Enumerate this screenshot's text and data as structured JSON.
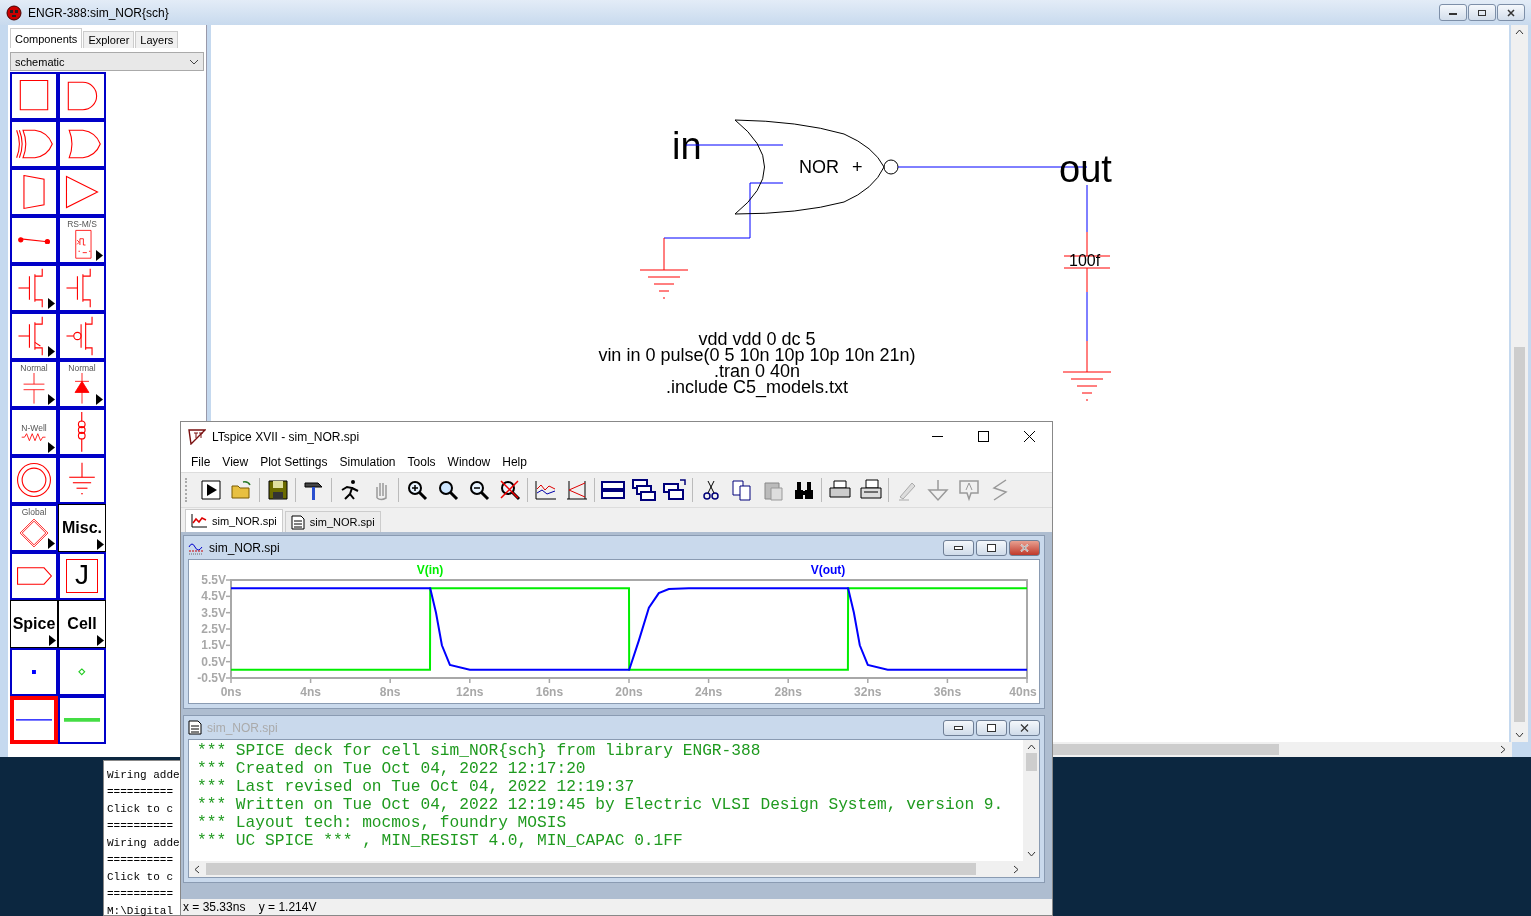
{
  "window": {
    "title": "ENGR-388:sim_NOR{sch}"
  },
  "side_tabs": [
    {
      "label": "Components",
      "selected": true
    },
    {
      "label": "Explorer",
      "selected": false
    },
    {
      "label": "Layers",
      "selected": false
    }
  ],
  "palette_select": {
    "value": "schematic"
  },
  "palette": [
    {
      "kind": "box",
      "menu": false,
      "selected": false
    },
    {
      "kind": "and",
      "menu": false,
      "selected": false
    },
    {
      "kind": "xor",
      "menu": false,
      "selected": false
    },
    {
      "kind": "or",
      "menu": false,
      "selected": false
    },
    {
      "kind": "mux",
      "menu": false,
      "selected": false
    },
    {
      "kind": "buffer",
      "menu": false,
      "selected": false
    },
    {
      "kind": "switch",
      "menu": false,
      "selected": false
    },
    {
      "kind": "flipflop",
      "label": "RS-M/S",
      "menu": true,
      "selected": false
    },
    {
      "kind": "nmos",
      "menu": true,
      "selected": false
    },
    {
      "kind": "mosfet",
      "menu": false,
      "selected": false
    },
    {
      "kind": "nmos4",
      "menu": true,
      "selected": false
    },
    {
      "kind": "pmos",
      "menu": false,
      "selected": false
    },
    {
      "kind": "capacitor",
      "label": "Normal",
      "menu": true,
      "selected": false
    },
    {
      "kind": "diode",
      "label": "Normal",
      "menu": true,
      "selected": false
    },
    {
      "kind": "resistor",
      "label": "N-Well",
      "menu": true,
      "selected": false
    },
    {
      "kind": "inductor",
      "menu": false,
      "selected": false
    },
    {
      "kind": "source",
      "menu": false,
      "selected": false
    },
    {
      "kind": "ground",
      "menu": false,
      "selected": false
    },
    {
      "kind": "global",
      "label": "Global",
      "menu": true,
      "selected": false
    },
    {
      "kind": "text",
      "label": "Misc.",
      "menu": true,
      "selected": false
    },
    {
      "kind": "export",
      "menu": false,
      "selected": false
    },
    {
      "kind": "jbox",
      "label": "J",
      "menu": false,
      "selected": false
    },
    {
      "kind": "text",
      "label": "Spice",
      "menu": true,
      "selected": false
    },
    {
      "kind": "text",
      "label": "Cell",
      "menu": true,
      "selected": false
    },
    {
      "kind": "pin",
      "menu": false,
      "selected": false
    },
    {
      "kind": "pin2",
      "menu": false,
      "selected": false
    },
    {
      "kind": "wire",
      "menu": false,
      "selected": true
    },
    {
      "kind": "wire2",
      "menu": false,
      "selected": false
    }
  ],
  "schematic": {
    "input_label": "in",
    "gate_label": "NOR",
    "gate_mark": "+",
    "output_label": "out",
    "capacitor_value": "100f",
    "spice_lines": [
      "vdd vdd 0 dc 5",
      "vin in 0 pulse(0 5 10n 10p 10p 10n 21n)",
      ".tran 0 40n",
      ".include C5_models.txt"
    ]
  },
  "messages": [
    "Wiring adde",
    "==========",
    "Click to c",
    "==========",
    "Wiring adde",
    "==========",
    "Click to c",
    "==========",
    "M:\\Digital"
  ],
  "ltspice": {
    "title": "LTspice XVII - sim_NOR.spi",
    "menu": [
      "File",
      "View",
      "Plot Settings",
      "Simulation",
      "Tools",
      "Window",
      "Help"
    ],
    "tabs": [
      {
        "label": "sim_NOR.spi",
        "kind": "plot",
        "selected": true
      },
      {
        "label": "sim_NOR.spi",
        "kind": "netlist",
        "selected": false
      }
    ],
    "plot_window": {
      "title": "sim_NOR.spi",
      "active": true,
      "chart_data": {
        "type": "line",
        "x": [
          0,
          10,
          10.01,
          10.3,
          10.6,
          11,
          12,
          20,
          20.01,
          20.5,
          21,
          21.5,
          22,
          23,
          31,
          31.01,
          31.3,
          31.6,
          32,
          33,
          40
        ],
        "series": [
          {
            "name": "V(in)",
            "color": "#00ee00",
            "values": [
              0,
              0,
              5,
              5,
              5,
              5,
              5,
              5,
              0,
              0,
              0,
              0,
              0,
              0,
              0,
              5,
              5,
              5,
              5,
              5,
              5
            ]
          },
          {
            "name": "V(out)",
            "color": "#0000ff",
            "values": [
              5,
              5,
              5,
              3.5,
              1.5,
              0.3,
              0,
              0,
              0,
              1.8,
              3.8,
              4.7,
              4.95,
              5,
              5,
              5,
              3.5,
              1.5,
              0.3,
              0,
              0
            ]
          }
        ],
        "xlim": [
          0,
          40
        ],
        "ylim": [
          -0.5,
          5.5
        ],
        "xticks": [
          {
            "value": 0,
            "label": "0ns"
          },
          {
            "value": 4,
            "label": "4ns"
          },
          {
            "value": 8,
            "label": "8ns"
          },
          {
            "value": 12,
            "label": "12ns"
          },
          {
            "value": 16,
            "label": "16ns"
          },
          {
            "value": 20,
            "label": "20ns"
          },
          {
            "value": 24,
            "label": "24ns"
          },
          {
            "value": 28,
            "label": "28ns"
          },
          {
            "value": 32,
            "label": "32ns"
          },
          {
            "value": 36,
            "label": "36ns"
          },
          {
            "value": 40,
            "label": "40ns"
          }
        ],
        "yticks": [
          {
            "value": 5.5,
            "label": "5.5V"
          },
          {
            "value": 4.5,
            "label": "4.5V"
          },
          {
            "value": 3.5,
            "label": "3.5V"
          },
          {
            "value": 2.5,
            "label": "2.5V"
          },
          {
            "value": 1.5,
            "label": "1.5V"
          },
          {
            "value": 0.5,
            "label": "0.5V"
          },
          {
            "value": -0.5,
            "label": "-0.5V"
          }
        ]
      }
    },
    "netlist_window": {
      "title": "sim_NOR.spi",
      "active": false,
      "lines": [
        "*** SPICE deck for cell sim_NOR{sch} from library ENGR-388",
        "*** Created on Tue Oct 04, 2022 12:17:20",
        "*** Last revised on Tue Oct 04, 2022 12:19:37",
        "*** Written on Tue Oct 04, 2022 12:19:45 by Electric VLSI Design System, version 9.",
        "*** Layout tech: mocmos, foundry MOSIS",
        "*** UC SPICE *** , MIN_RESIST 4.0, MIN_CAPAC 0.1FF"
      ]
    },
    "status": "x = 35.33ns    y = 1.214V"
  }
}
